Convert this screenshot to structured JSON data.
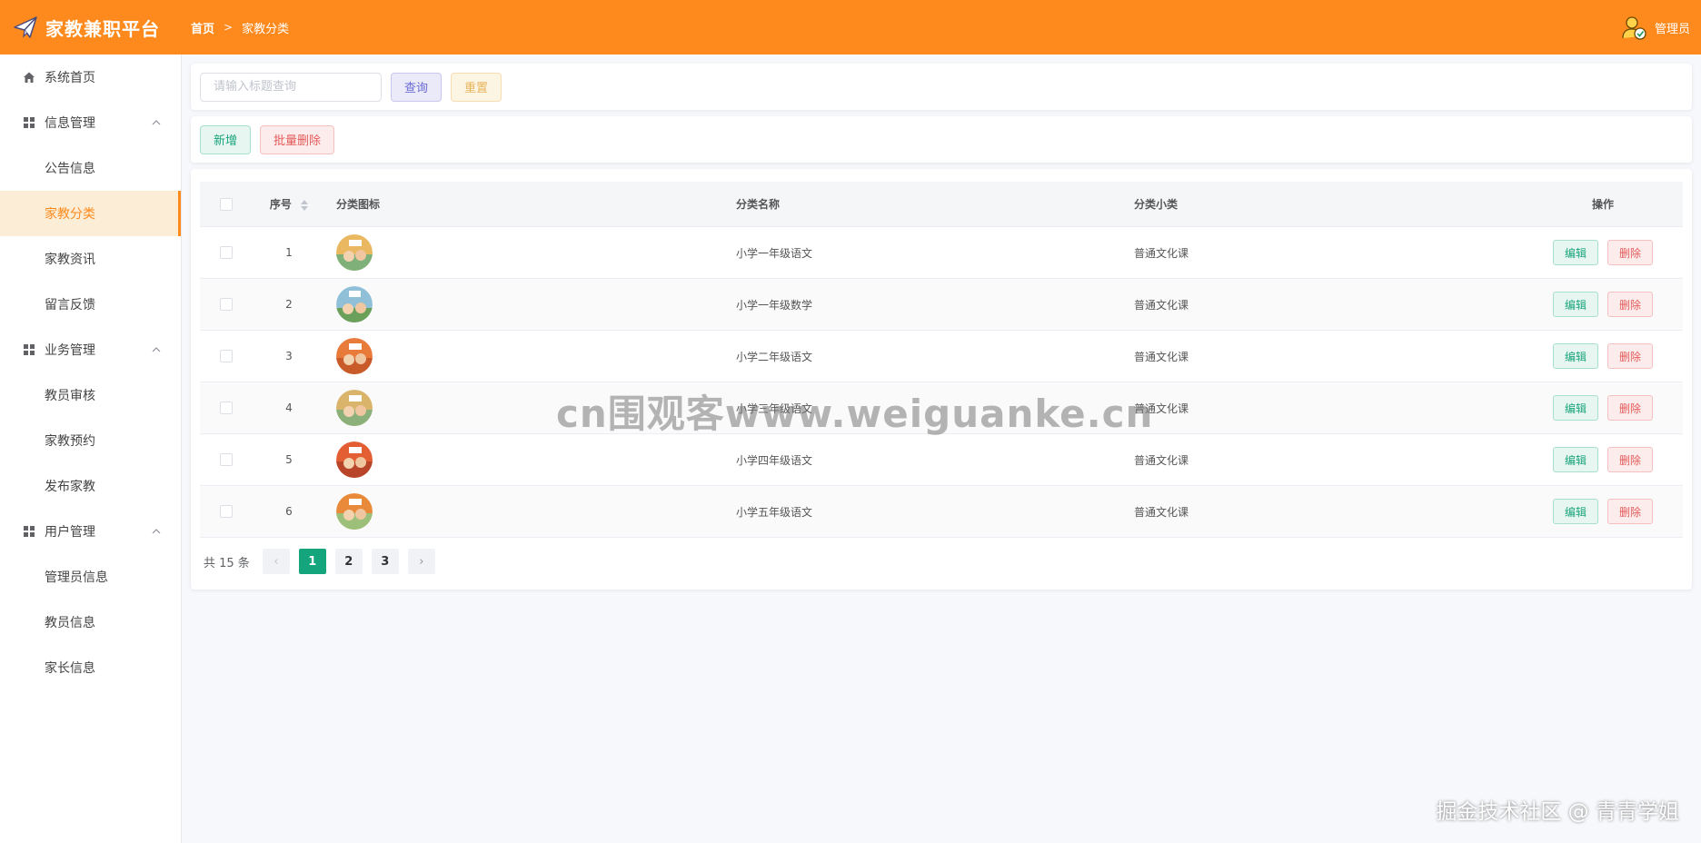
{
  "header": {
    "app_title": "家教兼职平台",
    "breadcrumb": [
      "首页",
      "家教分类"
    ],
    "user_name": "管理员",
    "bg_color": "#fe8a1e"
  },
  "sidebar": {
    "items": [
      {
        "label": "系统首页",
        "icon": "home-icon"
      },
      {
        "label": "信息管理",
        "icon": "grid-icon",
        "expanded": true,
        "children": [
          "公告信息",
          "家教分类",
          "家教资讯",
          "留言反馈"
        ]
      },
      {
        "label": "业务管理",
        "icon": "grid-icon",
        "expanded": true,
        "children": [
          "教员审核",
          "家教预约",
          "发布家教"
        ]
      },
      {
        "label": "用户管理",
        "icon": "grid-icon",
        "expanded": true,
        "children": [
          "管理员信息",
          "教员信息",
          "家长信息"
        ]
      }
    ],
    "active": "家教分类"
  },
  "search": {
    "placeholder": "请输入标题查询",
    "query_label": "查询",
    "reset_label": "重置"
  },
  "actions": {
    "add_label": "新增",
    "bulk_delete_label": "批量删除"
  },
  "table": {
    "columns": [
      "序号",
      "分类图标",
      "分类名称",
      "分类小类",
      "操作"
    ],
    "rows": [
      {
        "seq": "1",
        "name": "小学一年级语文",
        "sub": "普通文化课"
      },
      {
        "seq": "2",
        "name": "小学一年级数学",
        "sub": "普通文化课"
      },
      {
        "seq": "3",
        "name": "小学二年级语文",
        "sub": "普通文化课"
      },
      {
        "seq": "4",
        "name": "小学三年级语文",
        "sub": "普通文化课"
      },
      {
        "seq": "5",
        "name": "小学四年级语文",
        "sub": "普通文化课"
      },
      {
        "seq": "6",
        "name": "小学五年级语文",
        "sub": "普通文化课"
      }
    ],
    "edit_label": "编辑",
    "delete_label": "删除"
  },
  "pagination": {
    "total_text": "共 15 条",
    "pages": [
      "1",
      "2",
      "3"
    ],
    "current": "1",
    "prev": "‹",
    "next": "›"
  },
  "watermarks": {
    "center": "cn围观客www.weiguanke.cn",
    "corner": "掘金技术社区 @ 青青学姐"
  }
}
